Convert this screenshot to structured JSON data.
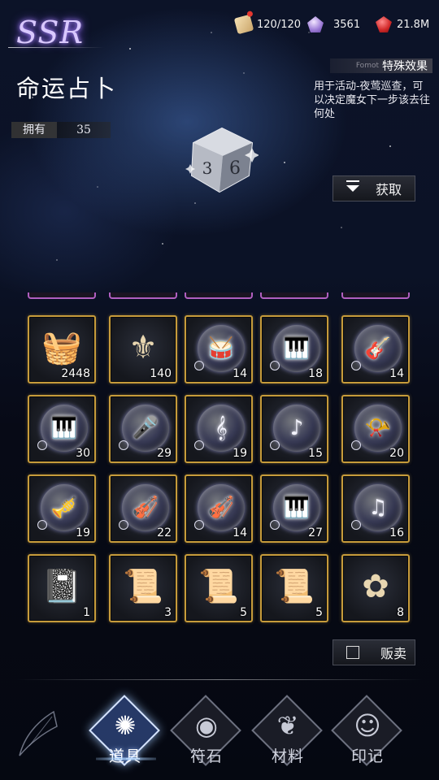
{
  "header": {
    "rarity": "SSR",
    "resources": [
      {
        "icon": "ticket-icon",
        "value": "120/120"
      },
      {
        "icon": "crystal-icon",
        "value": "3561"
      },
      {
        "icon": "ruby-icon",
        "value": "21.8M"
      }
    ]
  },
  "item": {
    "name": "命运占卜",
    "owned_label": "拥有",
    "owned_value": "35",
    "effect_small": "Fomot",
    "effect_label": "特殊效果",
    "effect_desc": "用于活动-夜莺巡查，可以决定魔女下一步该去往何处",
    "obtain_label": "获取"
  },
  "grid": {
    "items": [
      {
        "icon": "basket-icon",
        "count": "2448",
        "glyph": "🧺",
        "orb": false
      },
      {
        "icon": "crest-icon",
        "count": "140",
        "glyph": "⚜",
        "orb": false
      },
      {
        "icon": "drum-icon",
        "count": "14",
        "glyph": "🥁",
        "orb": true
      },
      {
        "icon": "melodica-icon",
        "count": "18",
        "glyph": "🎹",
        "orb": true
      },
      {
        "icon": "guitar-icon",
        "count": "14",
        "glyph": "🎸",
        "orb": true
      },
      {
        "icon": "keyboard-icon",
        "count": "30",
        "glyph": "🎹",
        "orb": true
      },
      {
        "icon": "microphone-icon",
        "count": "29",
        "glyph": "🎤",
        "orb": true
      },
      {
        "icon": "clarinet-icon",
        "count": "19",
        "glyph": "𝄞",
        "orb": true
      },
      {
        "icon": "oboe-icon",
        "count": "15",
        "glyph": "♪",
        "orb": true
      },
      {
        "icon": "horn-icon",
        "count": "20",
        "glyph": "📯",
        "orb": true
      },
      {
        "icon": "trombone-icon",
        "count": "19",
        "glyph": "🎺",
        "orb": true
      },
      {
        "icon": "violin-icon",
        "count": "22",
        "glyph": "🎻",
        "orb": true
      },
      {
        "icon": "cello-icon",
        "count": "14",
        "glyph": "🎻",
        "orb": true
      },
      {
        "icon": "piano-icon",
        "count": "27",
        "glyph": "🎹",
        "orb": true
      },
      {
        "icon": "harp-icon",
        "count": "16",
        "glyph": "♫",
        "orb": true
      },
      {
        "icon": "notebook-icon",
        "count": "1",
        "glyph": "📓",
        "orb": false
      },
      {
        "icon": "sheet-music-icon",
        "count": "3",
        "glyph": "📜",
        "orb": false
      },
      {
        "icon": "sheet-music-icon",
        "count": "5",
        "glyph": "📜",
        "orb": false
      },
      {
        "icon": "sheet-music-icon",
        "count": "5",
        "glyph": "📜",
        "orb": false
      },
      {
        "icon": "flower-icon",
        "count": "8",
        "glyph": "✿",
        "orb": false
      }
    ]
  },
  "sell_label": "贩卖",
  "tabs": [
    {
      "label": "道具",
      "icon": "items-tab-icon",
      "active": true
    },
    {
      "label": "符石",
      "icon": "runestone-tab-icon",
      "active": false
    },
    {
      "label": "材料",
      "icon": "materials-tab-icon",
      "active": false
    },
    {
      "label": "印记",
      "icon": "mark-tab-icon",
      "active": false
    }
  ]
}
